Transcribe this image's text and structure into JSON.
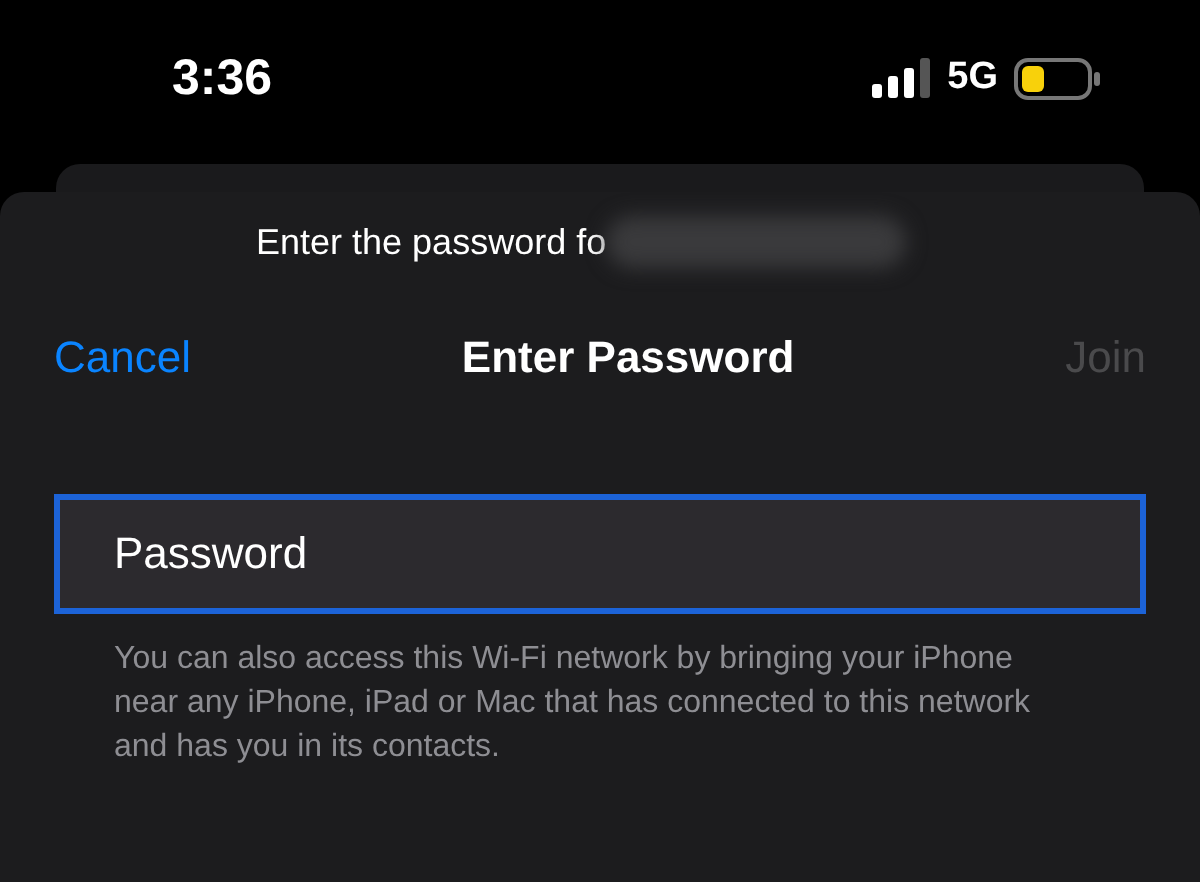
{
  "status_bar": {
    "time": "3:36",
    "network": "5G"
  },
  "sheet": {
    "prompt": "Enter the password fo",
    "nav": {
      "cancel": "Cancel",
      "title": "Enter Password",
      "join": {
        "label": "Join",
        "disabled": true
      }
    },
    "password_field": {
      "placeholder": "Password",
      "focused": true
    },
    "hint": "You can also access this Wi-Fi network by bringing your iPhone near any iPhone, iPad or Mac that has connected to this network and has you in its contacts."
  }
}
